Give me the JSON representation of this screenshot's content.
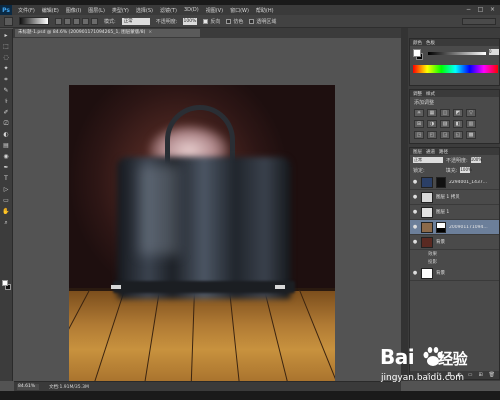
{
  "app": {
    "logo": "Ps",
    "menu": [
      "文件(F)",
      "编辑(E)",
      "图像(I)",
      "图层(L)",
      "类型(Y)",
      "选择(S)",
      "滤镜(T)",
      "3D(D)",
      "视图(V)",
      "窗口(W)",
      "帮助(H)"
    ],
    "window_controls": [
      "−",
      "□",
      "×"
    ]
  },
  "options_bar": {
    "mode_label": "模式:",
    "mode_value": "正常",
    "opacity_label": "不透明度:",
    "opacity_value": "100%",
    "reverse_label": "反向",
    "dither_label": "仿色",
    "transparency_label": "透明区域"
  },
  "document": {
    "tab_title": "未标题-1.psd @ 84.6% (200901171094265_1, 图层蒙版/8)",
    "tab_close": "×"
  },
  "tools": [
    "▸",
    "⬚",
    "◌",
    "✦",
    "⌗",
    "✎",
    "⚕",
    "✐",
    "⎚",
    "◐",
    "▤",
    "◉",
    "✒",
    "T",
    "▷",
    "▭",
    "✋",
    "⌕"
  ],
  "color_panel": {
    "tabs": [
      "颜色",
      "色板"
    ],
    "slider_value": "0"
  },
  "adjustments_panel": {
    "tabs": [
      "调整",
      "样式"
    ],
    "add_label": "添加调整",
    "icons": [
      "☀",
      "▦",
      "◫",
      "◩",
      "▽",
      "⊞",
      "◑",
      "▨",
      "◧",
      "▥",
      "◳",
      "◰",
      "◲",
      "◱",
      "▩"
    ]
  },
  "layers_panel": {
    "tabs": [
      "图层",
      "通道",
      "路径"
    ],
    "blend_mode": "正常",
    "opacity_label": "不透明度:",
    "opacity_value": "100%",
    "lock_label": "锁定:",
    "fill_label": "填充:",
    "fill_value": "100%",
    "layers": [
      {
        "name": "2294001_1437...",
        "selected": false
      },
      {
        "name": "图层 1 拷贝",
        "selected": false
      },
      {
        "name": "图层 1",
        "selected": false
      },
      {
        "name": "200901171094...",
        "selected": true
      },
      {
        "name": "背景",
        "selected": false
      }
    ],
    "effects": [
      "效果",
      "投影"
    ],
    "bottom_layer": "背景",
    "footer_icons": [
      "∞",
      "fx",
      "◘",
      "◐",
      "▭",
      "⊞",
      "🗑"
    ]
  },
  "status_bar": {
    "zoom": "84.61%",
    "doc_info": "文档:1.91M/35.3M"
  },
  "watermark": {
    "brand": "Bai",
    "brand_tail": "经验",
    "url": "jingyan.baidu.com"
  },
  "colors": {
    "ui_dark": "#3c3c3c",
    "canvas_bg": "#535353",
    "selection": "#6c7f9a"
  }
}
